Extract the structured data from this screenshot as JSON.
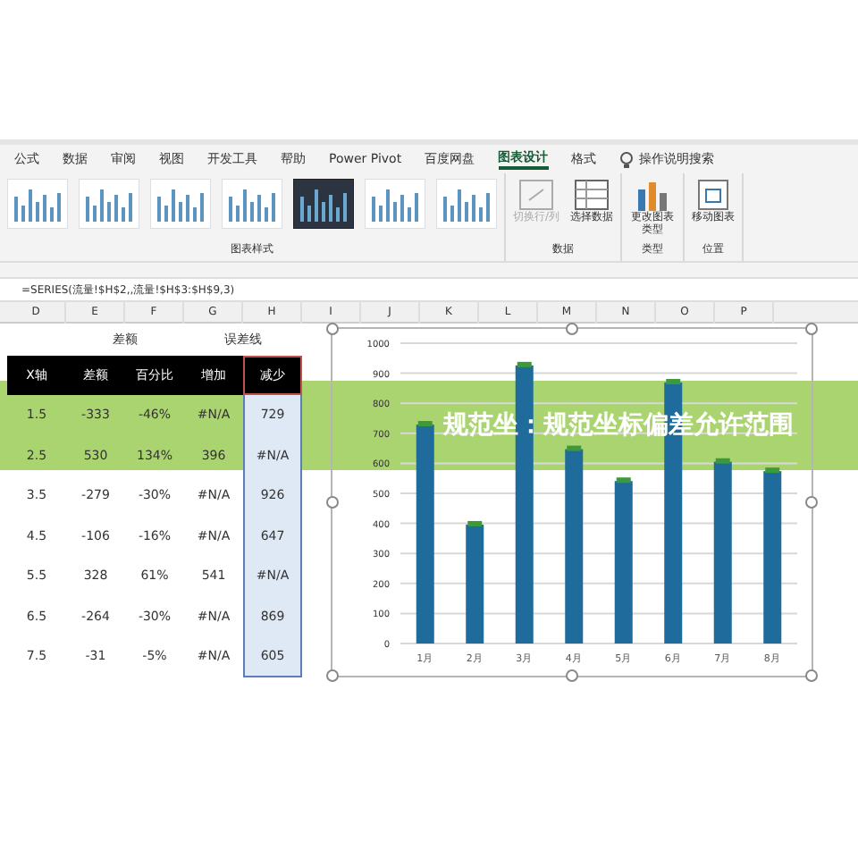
{
  "ribbon_tabs": [
    {
      "label": "公式",
      "selected": false
    },
    {
      "label": "数据",
      "selected": false
    },
    {
      "label": "审阅",
      "selected": false
    },
    {
      "label": "视图",
      "selected": false
    },
    {
      "label": "开发工具",
      "selected": false
    },
    {
      "label": "帮助",
      "selected": false
    },
    {
      "label": "Power Pivot",
      "selected": false
    },
    {
      "label": "百度网盘",
      "selected": false
    },
    {
      "label": "图表设计",
      "selected": true
    },
    {
      "label": "格式",
      "selected": false
    }
  ],
  "tell_me": "操作说明搜索",
  "chart_styles": [
    {
      "selected": false
    },
    {
      "selected": false
    },
    {
      "selected": false
    },
    {
      "selected": false
    },
    {
      "selected": true
    },
    {
      "selected": false
    },
    {
      "selected": false
    }
  ],
  "ribbon_groups": [
    {
      "label": "图表样式"
    },
    {
      "label": "数据",
      "buttons": [
        {
          "label": "切换行/列",
          "kind": "switch",
          "disabled": true
        },
        {
          "label": "选择数据",
          "kind": "select",
          "disabled": false
        }
      ]
    },
    {
      "label": "类型",
      "buttons": [
        {
          "label": "更改图表类型",
          "kind": "type",
          "disabled": false
        }
      ]
    },
    {
      "label": "位置",
      "buttons": [
        {
          "label": "移动图表",
          "kind": "move",
          "disabled": false
        }
      ]
    }
  ],
  "formula": "=SERIES(流量!$H$2,,流量!$H$3:$H$9,3)",
  "columns": [
    "D",
    "E",
    "F",
    "G",
    "H",
    "I",
    "J",
    "K",
    "L",
    "M",
    "N",
    "O",
    "P"
  ],
  "group_labels": [
    "差额",
    "误差线"
  ],
  "table": {
    "columns": [
      {
        "label": "X轴",
        "selected": false
      },
      {
        "label": "差额",
        "selected": false
      },
      {
        "label": "百分比",
        "selected": false
      },
      {
        "label": "增加",
        "selected": false
      },
      {
        "label": "减少",
        "selected": true
      }
    ],
    "rows": [
      [
        "1.5",
        "-333",
        "-46%",
        "#N/A",
        "729"
      ],
      [
        "2.5",
        "530",
        "134%",
        "396",
        "#N/A"
      ],
      [
        "3.5",
        "-279",
        "-30%",
        "#N/A",
        "926"
      ],
      [
        "4.5",
        "-106",
        "-16%",
        "#N/A",
        "647"
      ],
      [
        "5.5",
        "328",
        "61%",
        "541",
        "#N/A"
      ],
      [
        "6.5",
        "-264",
        "-30%",
        "#N/A",
        "869"
      ],
      [
        "7.5",
        "-31",
        "-5%",
        "#N/A",
        "605"
      ]
    ]
  },
  "chart": {
    "chart_data": {
      "type": "bar",
      "categories": [
        "1月",
        "2月",
        "3月",
        "4月",
        "5月",
        "6月",
        "7月",
        "8月"
      ],
      "grid": true,
      "series": [
        {
          "color": "#1f6b9c",
          "values": [
            729,
            396,
            926,
            647,
            541,
            869,
            605,
            574
          ]
        }
      ],
      "ylim": [
        0,
        1000
      ],
      "yticks": [
        0,
        100,
        200,
        300,
        400,
        500,
        600,
        700,
        800,
        900,
        1000
      ]
    }
  },
  "banner": "规范坐：规范坐标偏差允许范围"
}
